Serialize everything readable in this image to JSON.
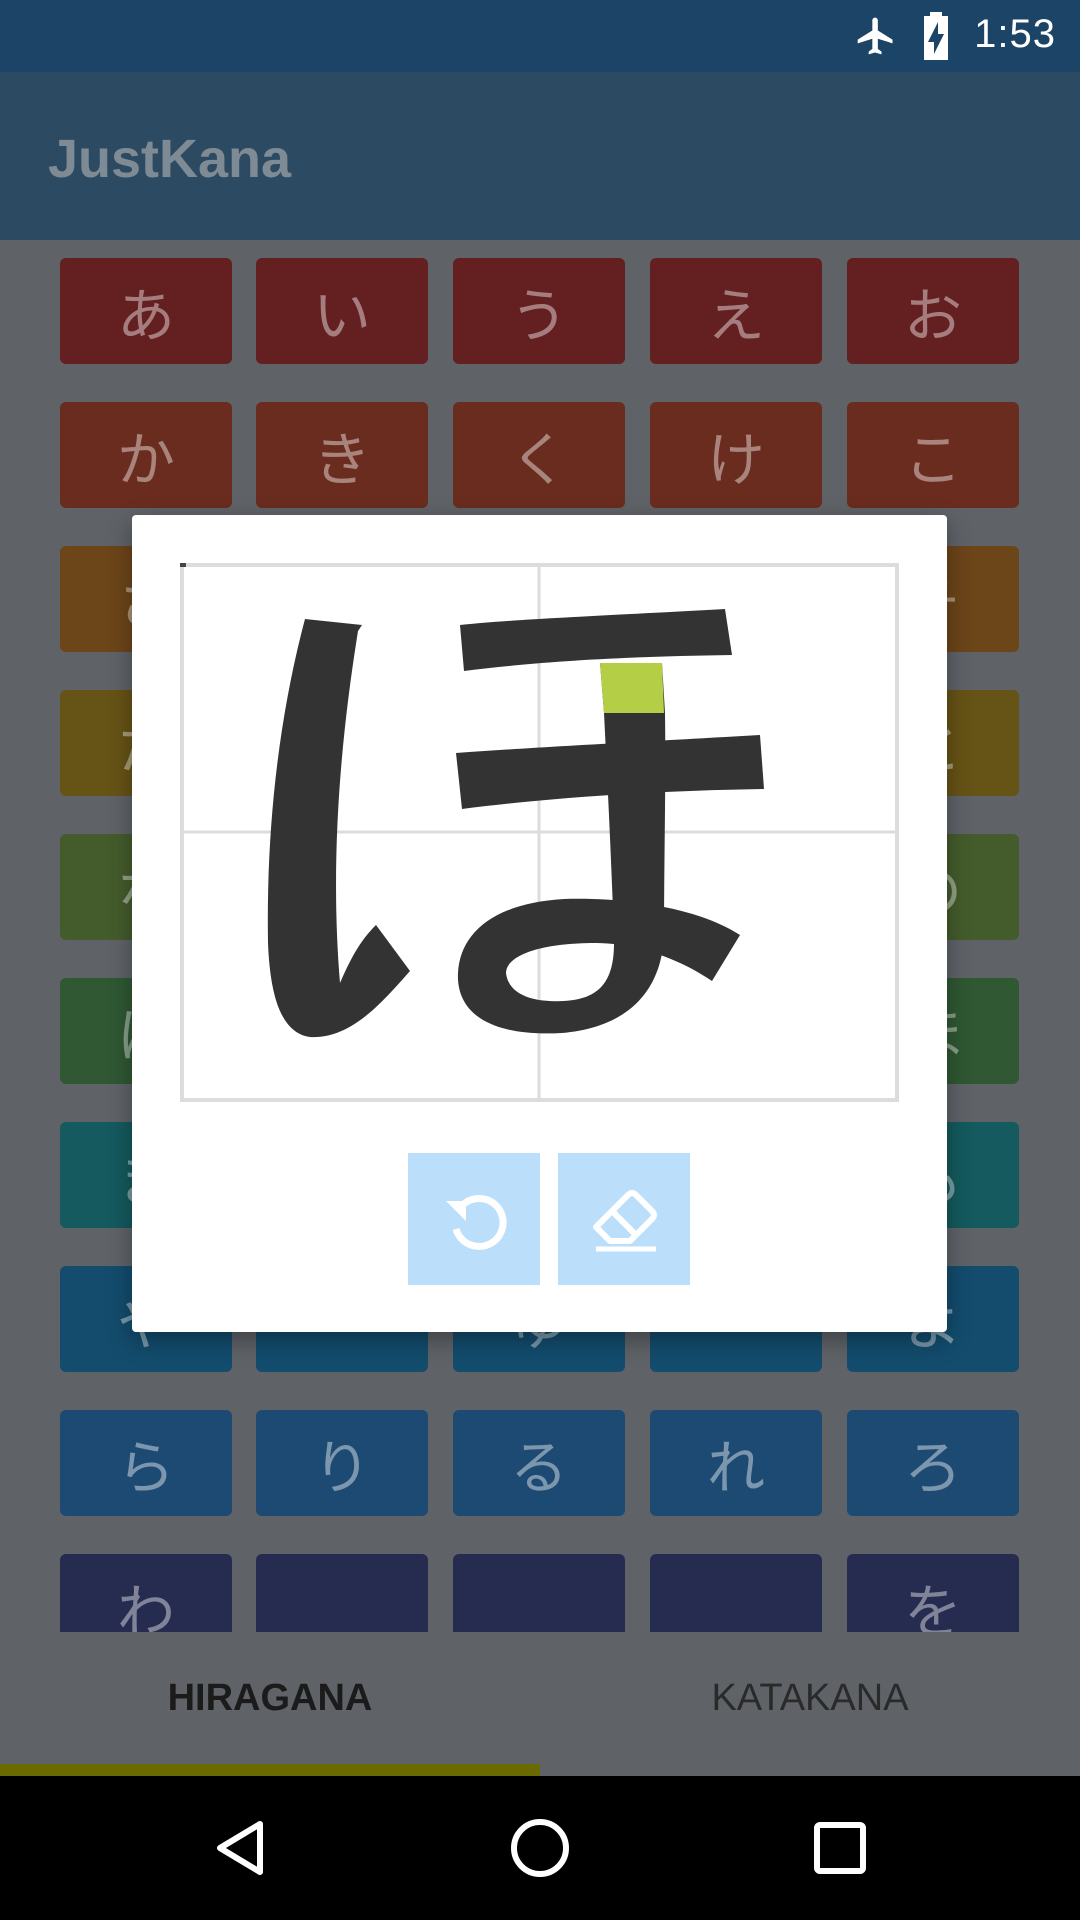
{
  "status_bar": {
    "time": "1:53",
    "icons": [
      "airplane-mode-icon",
      "battery-charging-icon"
    ]
  },
  "app_bar": {
    "title": "JustKana"
  },
  "grid": {
    "rows": [
      {
        "color": "#641f21",
        "cells": [
          "あ",
          "い",
          "う",
          "え",
          "お"
        ]
      },
      {
        "color": "#6a2c1e",
        "cells": [
          "か",
          "き",
          "く",
          "け",
          "こ"
        ]
      },
      {
        "color": "#6c4519",
        "cells": [
          "さ",
          "",
          "",
          "",
          "そ"
        ]
      },
      {
        "color": "#665316",
        "cells": [
          "た",
          "",
          "",
          "",
          "と"
        ]
      },
      {
        "color": "#445c2c",
        "cells": [
          "な",
          "",
          "",
          "",
          "の"
        ]
      },
      {
        "color": "#2f5833",
        "cells": [
          "は",
          "",
          "",
          "",
          "ほ"
        ]
      },
      {
        "color": "#145a5e",
        "cells": [
          "ま",
          "",
          "",
          "",
          "も"
        ]
      },
      {
        "color": "#134c6d",
        "cells": [
          "や",
          "",
          "ゆ",
          "",
          "よ"
        ]
      },
      {
        "color": "#1d4a72",
        "cells": [
          "ら",
          "り",
          "る",
          "れ",
          "ろ"
        ]
      },
      {
        "color": "#262c50",
        "cells": [
          "わ",
          "",
          "",
          "",
          "を"
        ]
      }
    ]
  },
  "dialog": {
    "current_kana": "ほ",
    "highlight_color": "#b4cf45",
    "stroke_color": "#333333",
    "buttons": [
      {
        "name": "undo-button",
        "icon": "undo-icon"
      },
      {
        "name": "erase-button",
        "icon": "eraser-icon"
      }
    ],
    "button_color": "#bbdefb"
  },
  "tabs": [
    {
      "label": "HIRAGANA",
      "selected": true
    },
    {
      "label": "KATAKANA",
      "selected": false
    }
  ],
  "tab_indicator_color": "#6a6a00",
  "nav_bar": {
    "buttons": [
      "back-icon",
      "home-icon",
      "recents-icon"
    ]
  }
}
